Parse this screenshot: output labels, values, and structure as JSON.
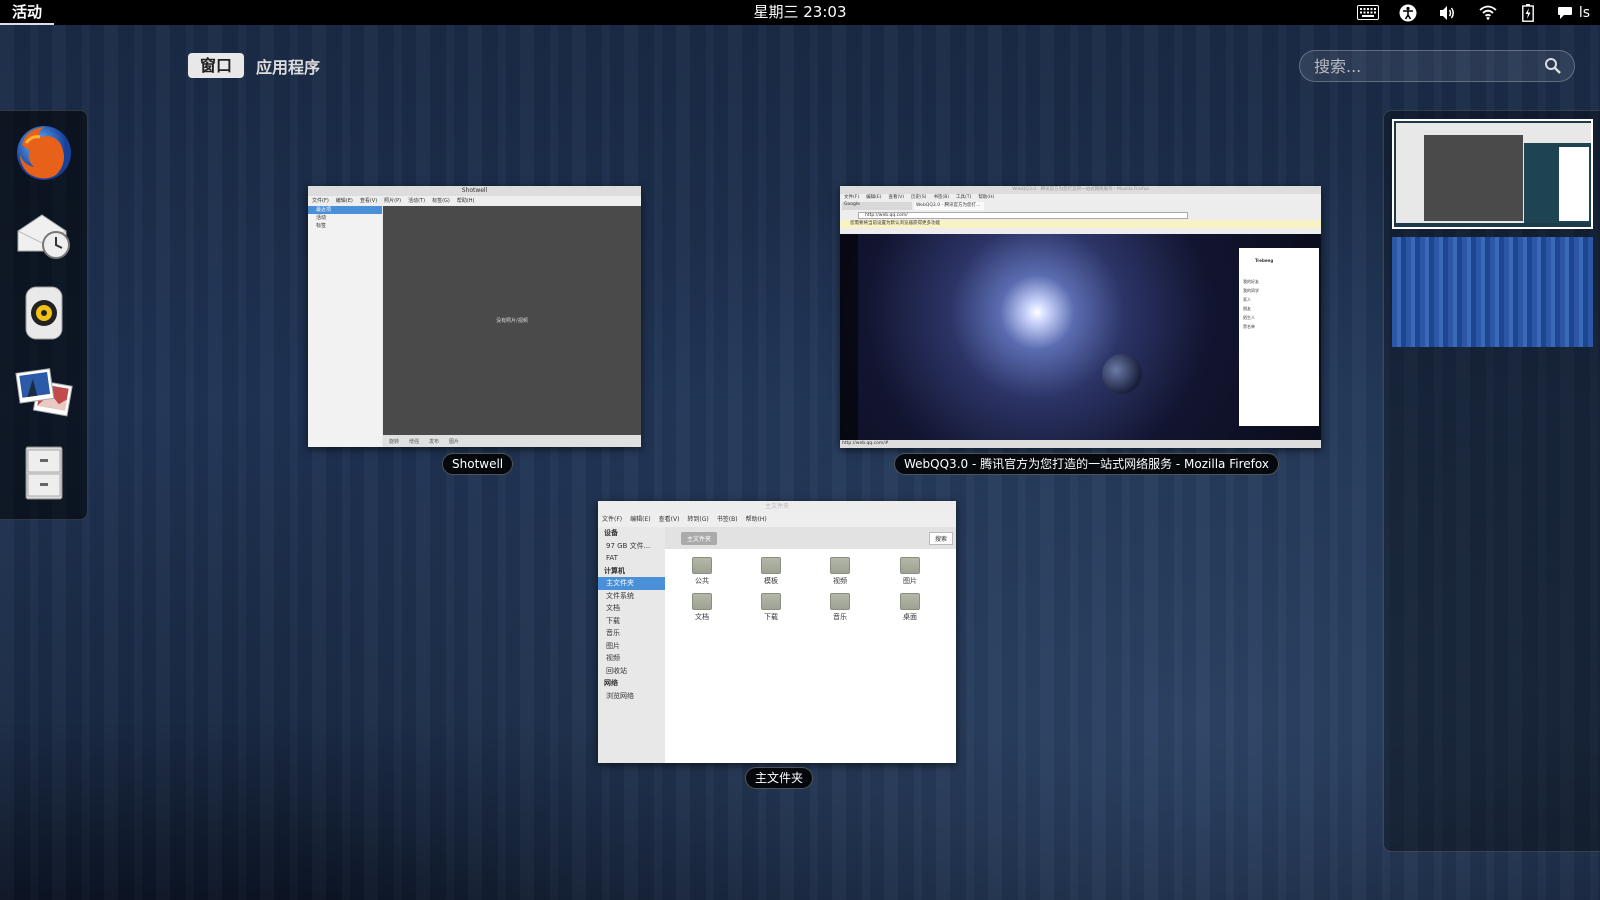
{
  "topbar": {
    "activities": "活动",
    "clock": "星期三 23:03",
    "user": "ls",
    "tray_icons": [
      "keyboard-icon",
      "accessibility-icon",
      "volume-icon",
      "wifi-icon",
      "battery-icon",
      "chat-icon"
    ]
  },
  "view_selector": {
    "windows_tab": "窗口",
    "apps_tab": "应用程序"
  },
  "search": {
    "placeholder": "搜索..."
  },
  "dash": {
    "apps": [
      "firefox-icon",
      "evolution-icon",
      "rhythmbox-icon",
      "shotwell-icon",
      "files-icon"
    ]
  },
  "windows": {
    "shotwell": {
      "caption": "Shotwell",
      "title": "Shotwell",
      "menu": [
        "文件(F)",
        "编辑(E)",
        "查看(V)",
        "照片(P)",
        "活动(T)",
        "标签(G)",
        "帮助(H)"
      ],
      "sidebar": [
        "最近项",
        "活动",
        "标签"
      ],
      "empty_text": "没有照片/视频",
      "status": [
        "旋转",
        "增强",
        "发布",
        "图片"
      ]
    },
    "firefox": {
      "caption": "WebQQ3.0 - 腾讯官方为您打造的一站式网络服务 - Mozilla Firefox",
      "title": "WebQQ3.0 - 腾讯官方为您打造的一站式网络服务 - Mozilla Firefox",
      "menu": [
        "文件(F)",
        "编辑(E)",
        "查看(V)",
        "历史(S)",
        "书签(B)",
        "工具(T)",
        "帮助(H)"
      ],
      "tab1": "Google",
      "tab2": "WebQQ3.0 - 腾讯官方为您打...",
      "url": "http://web.qq.com/",
      "notice": "您需要将当前设置为默认浏览器获得更多功能",
      "qq_name": "Trebeng",
      "qq_groups": [
        "我的好友",
        "我的同学",
        "家人",
        "朋友",
        "陌生人",
        "黑名单"
      ],
      "status_url": "http://web.qq.com/#"
    },
    "nautilus": {
      "caption": "主文件夹",
      "title": "主文件夹",
      "menu": [
        "文件(F)",
        "编辑(E)",
        "查看(V)",
        "转到(G)",
        "书签(B)",
        "帮助(H)"
      ],
      "path": "主文件夹",
      "search_label": "搜索",
      "sidebar": {
        "devices_header": "设备",
        "devices": [
          "97 GB 文件...",
          "FAT"
        ],
        "computer_header": "计算机",
        "computer": [
          "主文件夹",
          "文件系统",
          "文档",
          "下载",
          "音乐",
          "图片",
          "视频",
          "回收站"
        ],
        "network_header": "网络",
        "network": [
          "浏览网络"
        ]
      },
      "folders": [
        "公共",
        "模板",
        "视频",
        "图片",
        "文档",
        "下载",
        "音乐",
        "桌面"
      ]
    }
  },
  "colors": {
    "background": "#1f3354",
    "selection": "#4a90d9"
  }
}
